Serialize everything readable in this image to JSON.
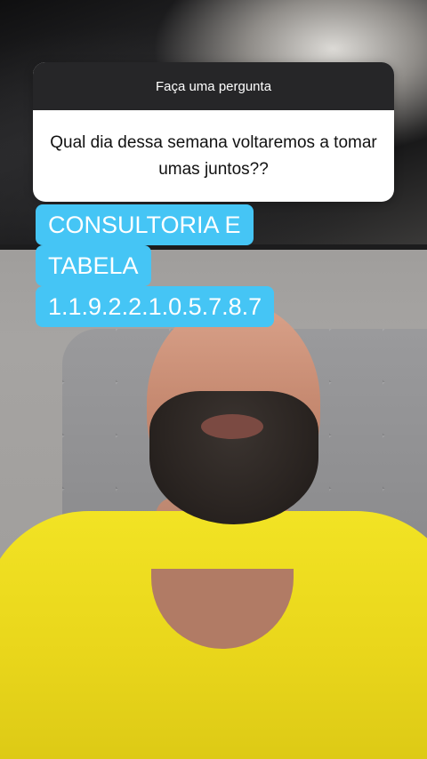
{
  "question_sticker": {
    "header": "Faça uma pergunta",
    "question": "Qual dia dessa semana voltaremos  a tomar umas juntos??"
  },
  "caption": {
    "lines": [
      "CONSULTORIA E",
      "TABELA",
      "1.1.9.2.2.1.0.5.7.8.7"
    ],
    "highlight_color": "#45c5f5",
    "text_color": "#ffffff"
  },
  "colors": {
    "shirt": "#f2e324",
    "card_header": "#262628"
  }
}
